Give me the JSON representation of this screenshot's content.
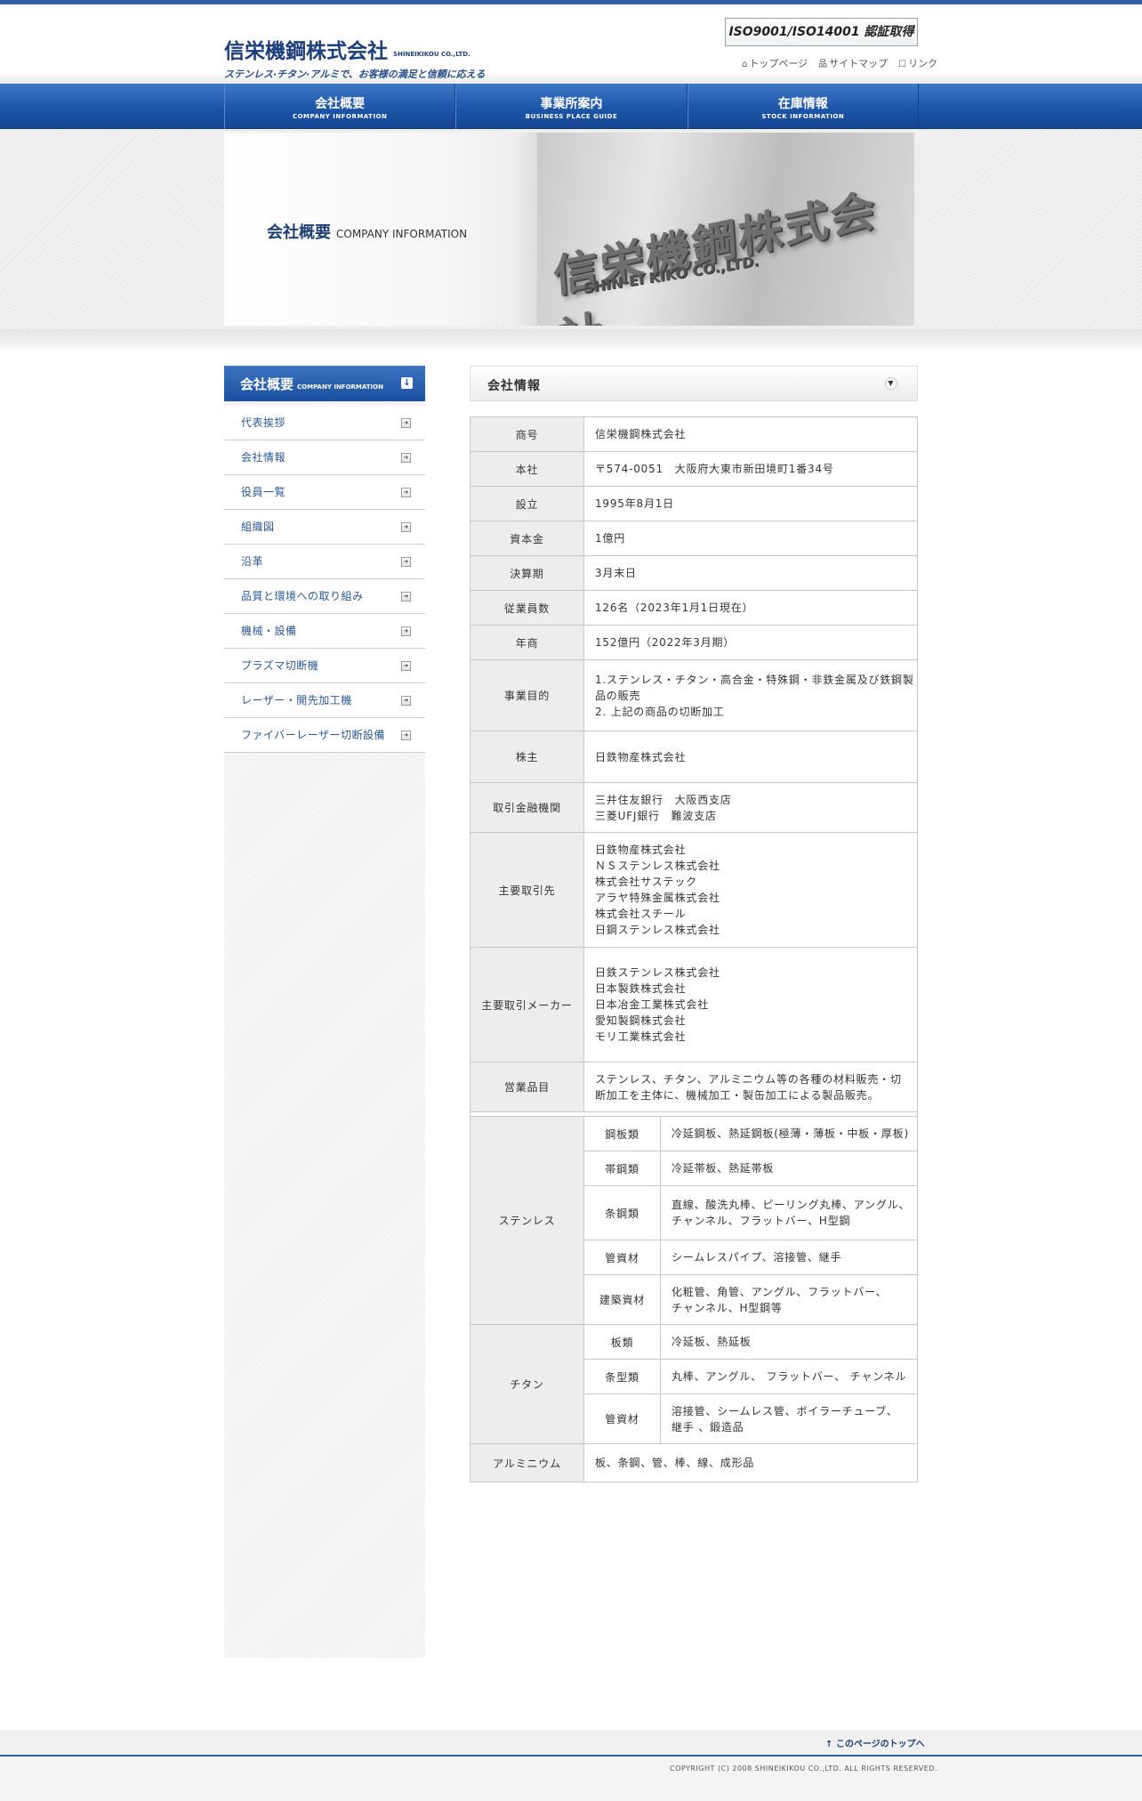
{
  "header": {
    "logo_main": "信栄機鋼株式会社",
    "logo_en": "SHINEIKIKOU CO.,LTD.",
    "tagline": "ステンレス·チタン·アルミで、お客様の満足と信頼に応える",
    "iso_badge": "ISO9001/ISO14001 認証取得",
    "links": [
      {
        "icon": "home-icon",
        "label": "トップページ"
      },
      {
        "icon": "sitemap-icon",
        "label": "サイトマップ"
      },
      {
        "icon": "link-icon",
        "label": "リンク"
      }
    ]
  },
  "nav": [
    {
      "jp": "会社概要",
      "en": "COMPANY INFORMATION"
    },
    {
      "jp": "事業所案内",
      "en": "BUSINESS PLACE GUIDE"
    },
    {
      "jp": "在庫情報",
      "en": "STOCK INFORMATION"
    }
  ],
  "hero": {
    "title_jp": "会社概要",
    "title_en": "COMPANY INFORMATION",
    "sign_jp": "信栄機鋼株式会社",
    "sign_en": "SHIN-EI KIKO CO.,LTD."
  },
  "sidebar": {
    "head_jp": "会社概要",
    "head_en": "COMPANY INFORMATION",
    "items": [
      "代表挨拶",
      "会社情報",
      "役員一覧",
      "組織図",
      "沿革",
      "品質と環境への取り組み",
      "機械・設備",
      "プラズマ切断機",
      "レーザー・開先加工機",
      "ファイバーレーザー切断設備"
    ]
  },
  "section": {
    "title": "会社情報"
  },
  "info": {
    "rows": [
      {
        "label": "商号",
        "lines": [
          "信栄機鋼株式会社"
        ]
      },
      {
        "label": "本社",
        "lines": [
          "〒574-0051　大阪府大東市新田境町1番34号"
        ]
      },
      {
        "label": "設立",
        "lines": [
          "1995年8月1日"
        ]
      },
      {
        "label": "資本金",
        "lines": [
          "1億円"
        ]
      },
      {
        "label": "決算期",
        "lines": [
          "3月末日"
        ]
      },
      {
        "label": "従業員数",
        "lines": [
          "126名（2023年1月1日現在）"
        ]
      },
      {
        "label": "年商",
        "lines": [
          "152億円（2022年3月期）"
        ]
      },
      {
        "label": "事業目的",
        "lines": [
          "1.ステンレス・チタン・高合金・特殊鋼・非鉄金属及び鉄鋼製",
          "品の販売",
          "2. 上記の商品の切断加工"
        ]
      },
      {
        "label": "株主",
        "lines": [
          "日鉄物産株式会社"
        ]
      },
      {
        "label": "取引金融機関",
        "lines": [
          "三井住友銀行　大阪西支店",
          "三菱UFJ銀行　難波支店"
        ]
      },
      {
        "label": "主要取引先",
        "lines": [
          "日鉄物産株式会社",
          "ＮＳステンレス株式会社",
          "株式会社サステック",
          "アラヤ特殊金属株式会社",
          "株式会社スチール",
          "日鋼ステンレス株式会社"
        ]
      },
      {
        "label": "主要取引メーカー",
        "lines": [
          "日鉄ステンレス株式会社",
          "日本製鉄株式会社",
          "日本冶金工業株式会社",
          "愛知製鋼株式会社",
          "モリ工業株式会社"
        ]
      },
      {
        "label": "営業品目",
        "lines": [
          "ステンレス、チタン、アルミニウム等の各種の材料販売・切",
          "断加工を主体に、機械加工・製缶加工による製品販売。"
        ]
      }
    ],
    "stainless": {
      "label": "ステンレス",
      "subs": [
        {
          "label": "鋼板類",
          "lines": [
            "冷延鋼板、熱延鋼板(極薄・薄板・中板・厚板)"
          ]
        },
        {
          "label": "帯鋼類",
          "lines": [
            "冷延帯板、熱延帯板"
          ]
        },
        {
          "label": "条鋼類",
          "lines": [
            "直線、酸洗丸棒、ピーリング丸棒、アングル、",
            "チャンネル、フラットバー、H型鋼"
          ]
        },
        {
          "label": "管資材",
          "lines": [
            "シームレスパイプ、溶接管、継手"
          ]
        },
        {
          "label": "建築資材",
          "lines": [
            "化粧管、角管、アングル、フラットバー、",
            "チャンネル、H型鋼等"
          ]
        }
      ]
    },
    "titanium": {
      "label": "チタン",
      "subs": [
        {
          "label": "板類",
          "lines": [
            "冷延板、熱延板"
          ]
        },
        {
          "label": "条型類",
          "lines": [
            "丸棒、アングル、 フラットバー、 チャンネル"
          ]
        },
        {
          "label": "管資材",
          "lines": [
            "溶接管、シームレス管、ボイラーチューブ、",
            "継手 、鍛造品"
          ]
        }
      ]
    },
    "aluminium": {
      "label": "アルミニウム",
      "lines": [
        "板、条鋼、管、棒、線、成形品"
      ]
    }
  },
  "footer": {
    "page_top": "このページのトップへ",
    "copyright": "COPYRIGHT (C) 2008 SHINEIKIKOU CO.,LTD. ALL RIGHTS RESERVED."
  }
}
